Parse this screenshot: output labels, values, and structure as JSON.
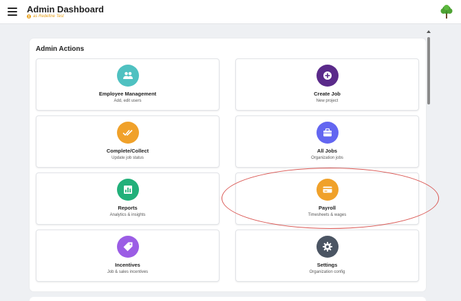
{
  "header": {
    "title": "Admin Dashboard",
    "subtitle": "as Redefine Test"
  },
  "panel": {
    "title": "Admin Actions"
  },
  "cards": [
    {
      "title": "Employee Management",
      "subtitle": "Add, edit users",
      "color": "#4fc1c1",
      "icon": "users-icon"
    },
    {
      "title": "Create Job",
      "subtitle": "New project",
      "color": "#5a2a8a",
      "icon": "plus-circle-icon"
    },
    {
      "title": "Complete/Collect",
      "subtitle": "Update job status",
      "color": "#f0a12a",
      "icon": "double-check-icon"
    },
    {
      "title": "All Jobs",
      "subtitle": "Organization jobs",
      "color": "#6366f1",
      "icon": "briefcase-icon"
    },
    {
      "title": "Reports",
      "subtitle": "Analytics & insights",
      "color": "#22b07a",
      "icon": "bar-chart-icon"
    },
    {
      "title": "Payroll",
      "subtitle": "Timesheets & wages",
      "color": "#f0a12a",
      "icon": "credit-card-icon"
    },
    {
      "title": "Incentives",
      "subtitle": "Job & sales incentives",
      "color": "#9b5de5",
      "icon": "tag-icon"
    },
    {
      "title": "Settings",
      "subtitle": "Organization config",
      "color": "#4b5563",
      "icon": "gear-icon"
    }
  ],
  "colors": {
    "accent_orange": "#e8a01a",
    "highlight": "#d9534f",
    "background": "#eef0f3"
  }
}
